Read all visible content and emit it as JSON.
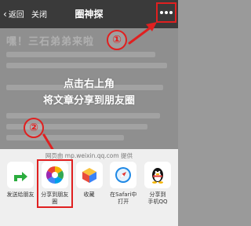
{
  "navbar": {
    "back_label": "返回",
    "close_label": "关闭",
    "title": "圈神探",
    "more_icon": "more-dots-icon"
  },
  "article": {
    "headline": "嘿！三石弟弟来啦"
  },
  "tips": {
    "line1": "点击右上角",
    "line2": "将文章分享到朋友圈"
  },
  "steps": {
    "step1": "①",
    "step2": "②"
  },
  "share_sheet": {
    "provider_text": "网页由 mp.weixin.qq.com 提供",
    "actions": [
      {
        "label": "发送给朋友",
        "icon": "share-arrow-icon"
      },
      {
        "label": "分享到朋友圈",
        "icon": "moments-icon"
      },
      {
        "label": "收藏",
        "icon": "favorite-cube-icon"
      },
      {
        "label": "在Safari中\n打开",
        "icon": "safari-icon"
      },
      {
        "label": "分享到\n手机QQ",
        "icon": "qq-penguin-icon"
      }
    ]
  },
  "colors": {
    "accent_red": "#e02020",
    "navbar_bg": "#3a3a3a",
    "sheet_bg": "#efefef",
    "wechat_green": "#2bad3e"
  }
}
